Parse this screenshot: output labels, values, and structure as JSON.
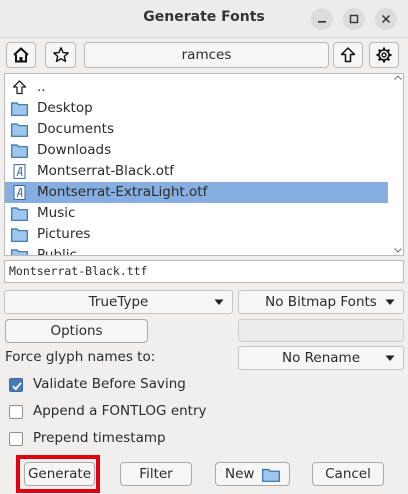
{
  "window": {
    "title": "Generate Fonts"
  },
  "toolbar": {
    "path": "ramces"
  },
  "files": [
    {
      "name": "..",
      "type": "up"
    },
    {
      "name": "Desktop",
      "type": "folder"
    },
    {
      "name": "Documents",
      "type": "folder"
    },
    {
      "name": "Downloads",
      "type": "folder"
    },
    {
      "name": "Montserrat-Black.otf",
      "type": "font"
    },
    {
      "name": "Montserrat-ExtraLight.otf",
      "type": "font",
      "selected": true
    },
    {
      "name": "Music",
      "type": "folder"
    },
    {
      "name": "Pictures",
      "type": "folder"
    },
    {
      "name": "Public",
      "type": "folder"
    }
  ],
  "filename": "Montserrat-Black.ttf",
  "format": {
    "selected": "TrueType"
  },
  "bitmap": {
    "selected": "No Bitmap Fonts"
  },
  "options_label": "Options",
  "force_glyph": {
    "label": "Force glyph names to:",
    "selected": "No Rename"
  },
  "checkboxes": [
    {
      "label": "Validate Before Saving",
      "checked": true
    },
    {
      "label": "Append a FONTLOG entry",
      "checked": false
    },
    {
      "label": "Prepend timestamp",
      "checked": false
    }
  ],
  "buttons": {
    "generate": "Generate",
    "filter": "Filter",
    "new": "New",
    "cancel": "Cancel"
  },
  "colors": {
    "selection": "#86aee0",
    "highlight": "#e0000f",
    "checkbox": "#4a78b4"
  }
}
